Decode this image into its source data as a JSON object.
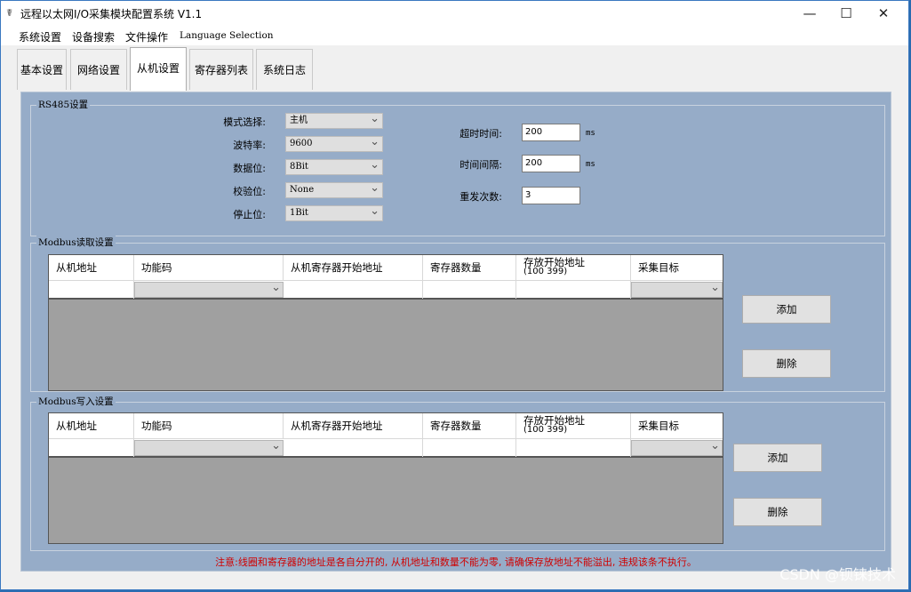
{
  "window": {
    "title": "远程以太网I/O采集模块配置系统 V1.1",
    "app_icon": "app-icon",
    "controls": {
      "minimize": "—",
      "maximize": "☐",
      "close": "✕"
    }
  },
  "menubar": {
    "items": [
      "系统设置",
      "设备搜索",
      "文件操作",
      "Language Selection"
    ]
  },
  "tabs": [
    "基本设置",
    "网络设置",
    "从机设置",
    "寄存器列表",
    "系统日志"
  ],
  "active_tab": "从机设置",
  "rs485": {
    "title": "RS485设置",
    "mode_label": "模式选择:",
    "mode_value": "主机",
    "baud_label": "波特率:",
    "baud_value": "9600",
    "databits_label": "数据位:",
    "databits_value": "8Bit",
    "parity_label": "校验位:",
    "parity_value": "None",
    "stopbits_label": "停止位:",
    "stopbits_value": "1Bit",
    "timeout_label": "超时时间:",
    "timeout_value": "200",
    "timeout_unit": "ms",
    "interval_label": "时间间隔:",
    "interval_value": "200",
    "interval_unit": "ms",
    "retry_label": "重发次数:",
    "retry_value": "3"
  },
  "read": {
    "title": "Modbus读取设置",
    "columns": [
      "从机地址",
      "功能码",
      "从机寄存器开始地址",
      "寄存器数量",
      "存放开始地址",
      "采集目标"
    ],
    "column_sub": "(100 399)",
    "add_label": "添加",
    "delete_label": "删除"
  },
  "write": {
    "title": "Modbus写入设置",
    "columns": [
      "从机地址",
      "功能码",
      "从机寄存器开始地址",
      "寄存器数量",
      "存放开始地址",
      "采集目标"
    ],
    "column_sub": "(100 399)",
    "add_label": "添加",
    "delete_label": "删除"
  },
  "notice": "注意:线圈和寄存器的地址是各自分开的, 从机地址和数量不能为零, 请确保存放地址不能溢出, 违规该条不执行。",
  "watermark": "CSDN @钡铼技术",
  "colors": {
    "panel": "#96acc8",
    "grid_empty": "#a0a0a0",
    "notice": "#d00000"
  }
}
